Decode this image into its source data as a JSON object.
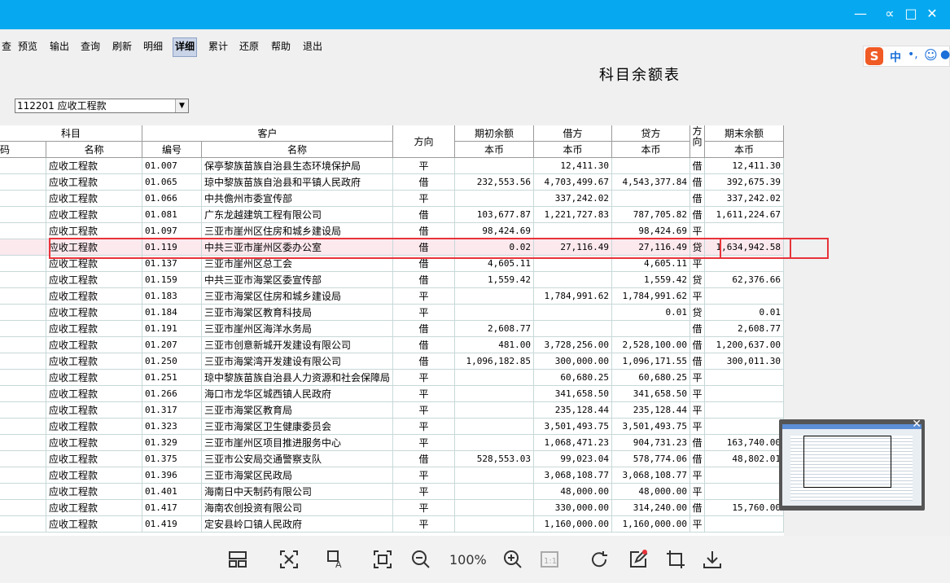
{
  "toolbar": {
    "items": [
      {
        "label": "查"
      },
      {
        "label": "预览"
      },
      {
        "label": "输出"
      },
      {
        "label": "查询"
      },
      {
        "label": "刷新"
      },
      {
        "label": "明细"
      },
      {
        "label": "详细"
      },
      {
        "label": "累计"
      },
      {
        "label": "还原"
      },
      {
        "label": "帮助"
      },
      {
        "label": "退出"
      }
    ]
  },
  "report": {
    "title": "科目余额表",
    "account_select": "112201 应收工程款"
  },
  "table": {
    "group_headers": {
      "subject": "科目",
      "customer": "客户",
      "direction": "方向",
      "opening": "期初余额",
      "debit": "借方",
      "credit": "贷方",
      "dir2": "方向",
      "ending": "期末余额"
    },
    "sub_headers": {
      "code_left": "码",
      "name": "名称",
      "cust_code": "编号",
      "cust_name": "名称",
      "opening_cur": "本币",
      "debit_cur": "本币",
      "credit_cur": "本币",
      "ending_cur": "本币"
    },
    "rows": [
      {
        "subject": "应收工程款",
        "code": "01.007",
        "customer": "保亭黎族苗族自治县生态环境保护局",
        "dir": "平",
        "opening": "",
        "debit": "12,411.30",
        "credit": "",
        "dir2": "借",
        "ending": "12,411.30"
      },
      {
        "subject": "应收工程款",
        "code": "01.065",
        "customer": "琼中黎族苗族自治县和平镇人民政府",
        "dir": "借",
        "opening": "232,553.56",
        "debit": "4,703,499.67",
        "credit": "4,543,377.84",
        "dir2": "借",
        "ending": "392,675.39"
      },
      {
        "subject": "应收工程款",
        "code": "01.066",
        "customer": "中共儋州市委宣传部",
        "dir": "平",
        "opening": "",
        "debit": "337,242.02",
        "credit": "",
        "dir2": "借",
        "ending": "337,242.02"
      },
      {
        "subject": "应收工程款",
        "code": "01.081",
        "customer": "广东龙越建筑工程有限公司",
        "dir": "借",
        "opening": "103,677.87",
        "debit": "1,221,727.83",
        "credit": "787,705.82",
        "dir2": "借",
        "ending": "1,611,224.67"
      },
      {
        "subject": "应收工程款",
        "code": "01.097",
        "customer": "三亚市崖州区住房和城乡建设局",
        "dir": "借",
        "opening": "98,424.69",
        "debit": "",
        "credit": "98,424.69",
        "dir2": "平",
        "ending": ""
      },
      {
        "subject": "应收工程款",
        "code": "01.119",
        "customer": "中共三亚市崖州区委办公室",
        "dir": "借",
        "opening": "0.02",
        "debit": "27,116.49",
        "credit": "27,116.49",
        "dir2": "贷",
        "ending": "1,634,942.58"
      },
      {
        "subject": "应收工程款",
        "code": "01.137",
        "customer": "三亚市崖州区总工会",
        "dir": "借",
        "opening": "4,605.11",
        "debit": "",
        "credit": "4,605.11",
        "dir2": "平",
        "ending": ""
      },
      {
        "subject": "应收工程款",
        "code": "01.159",
        "customer": "中共三亚市海棠区委宣传部",
        "dir": "借",
        "opening": "1,559.42",
        "debit": "",
        "credit": "1,559.42",
        "dir2": "贷",
        "ending": "62,376.66"
      },
      {
        "subject": "应收工程款",
        "code": "01.183",
        "customer": "三亚市海棠区住房和城乡建设局",
        "dir": "平",
        "opening": "",
        "debit": "1,784,991.62",
        "credit": "1,784,991.62",
        "dir2": "平",
        "ending": ""
      },
      {
        "subject": "应收工程款",
        "code": "01.184",
        "customer": "三亚市海棠区教育科技局",
        "dir": "平",
        "opening": "",
        "debit": "",
        "credit": "0.01",
        "dir2": "贷",
        "ending": "0.01"
      },
      {
        "subject": "应收工程款",
        "code": "01.191",
        "customer": "三亚市崖州区海洋水务局",
        "dir": "借",
        "opening": "2,608.77",
        "debit": "",
        "credit": "",
        "dir2": "借",
        "ending": "2,608.77"
      },
      {
        "subject": "应收工程款",
        "code": "01.207",
        "customer": "三亚市创意新城开发建设有限公司",
        "dir": "借",
        "opening": "481.00",
        "debit": "3,728,256.00",
        "credit": "2,528,100.00",
        "dir2": "借",
        "ending": "1,200,637.00"
      },
      {
        "subject": "应收工程款",
        "code": "01.250",
        "customer": "三亚市海棠湾开发建设有限公司",
        "dir": "借",
        "opening": "1,096,182.85",
        "debit": "300,000.00",
        "credit": "1,096,171.55",
        "dir2": "借",
        "ending": "300,011.30"
      },
      {
        "subject": "应收工程款",
        "code": "01.251",
        "customer": "琼中黎族苗族自治县人力资源和社会保障局",
        "dir": "平",
        "opening": "",
        "debit": "60,680.25",
        "credit": "60,680.25",
        "dir2": "平",
        "ending": ""
      },
      {
        "subject": "应收工程款",
        "code": "01.266",
        "customer": "海口市龙华区城西镇人民政府",
        "dir": "平",
        "opening": "",
        "debit": "341,658.50",
        "credit": "341,658.50",
        "dir2": "平",
        "ending": ""
      },
      {
        "subject": "应收工程款",
        "code": "01.317",
        "customer": "三亚市海棠区教育局",
        "dir": "平",
        "opening": "",
        "debit": "235,128.44",
        "credit": "235,128.44",
        "dir2": "平",
        "ending": ""
      },
      {
        "subject": "应收工程款",
        "code": "01.323",
        "customer": "三亚市海棠区卫生健康委员会",
        "dir": "平",
        "opening": "",
        "debit": "3,501,493.75",
        "credit": "3,501,493.75",
        "dir2": "平",
        "ending": ""
      },
      {
        "subject": "应收工程款",
        "code": "01.329",
        "customer": "三亚市崖州区项目推进服务中心",
        "dir": "平",
        "opening": "",
        "debit": "1,068,471.23",
        "credit": "904,731.23",
        "dir2": "借",
        "ending": "163,740.00"
      },
      {
        "subject": "应收工程款",
        "code": "01.375",
        "customer": "三亚市公安局交通警察支队",
        "dir": "借",
        "opening": "528,553.03",
        "debit": "99,023.04",
        "credit": "578,774.06",
        "dir2": "借",
        "ending": "48,802.01"
      },
      {
        "subject": "应收工程款",
        "code": "01.396",
        "customer": "三亚市海棠区民政局",
        "dir": "平",
        "opening": "",
        "debit": "3,068,108.77",
        "credit": "3,068,108.77",
        "dir2": "平",
        "ending": ""
      },
      {
        "subject": "应收工程款",
        "code": "01.401",
        "customer": "海南日中天制药有限公司",
        "dir": "平",
        "opening": "",
        "debit": "48,000.00",
        "credit": "48,000.00",
        "dir2": "平",
        "ending": ""
      },
      {
        "subject": "应收工程款",
        "code": "01.417",
        "customer": "海南农创投资有限公司",
        "dir": "平",
        "opening": "",
        "debit": "330,000.00",
        "credit": "314,240.00",
        "dir2": "借",
        "ending": "15,760.00"
      },
      {
        "subject": "应收工程款",
        "code": "01.419",
        "customer": "定安县岭口镇人民政府",
        "dir": "平",
        "opening": "",
        "debit": "1,160,000.00",
        "credit": "1,160,000.00",
        "dir2": "平",
        "ending": ""
      }
    ]
  },
  "viewer": {
    "zoom": "100%"
  },
  "ime": {
    "lang": "中"
  },
  "colors": {
    "titlebar": "#06a9f0",
    "highlight": "#e8333a"
  }
}
